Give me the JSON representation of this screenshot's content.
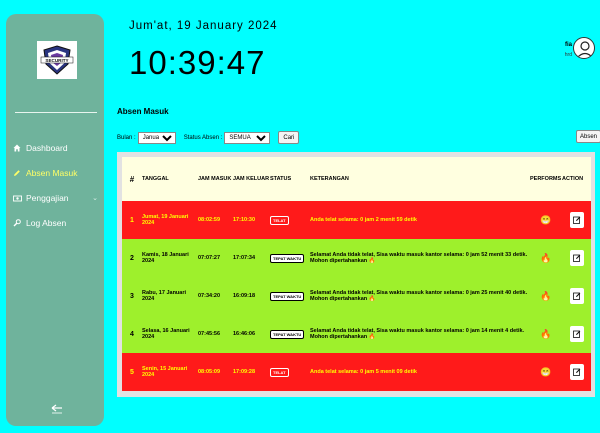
{
  "header": {
    "date": "Jum'at, 19 January 2024",
    "time": "10:39:47",
    "user_name": "fia",
    "user_role": "hrd"
  },
  "sidebar": {
    "logo_text": "SECURITY",
    "items": [
      {
        "label": "Dashboard",
        "icon": "home-icon",
        "active": false
      },
      {
        "label": "Absen Masuk",
        "icon": "pencil-icon",
        "active": true
      },
      {
        "label": "Penggajian",
        "icon": "money-icon",
        "active": false,
        "has_children": true
      },
      {
        "label": "Log Absen",
        "icon": "wrench-icon",
        "active": false
      }
    ]
  },
  "main": {
    "title": "Absen Masuk",
    "filter": {
      "bulan_label": "Bulan :",
      "bulan_value": "Januari",
      "status_label": "Status Absen :",
      "status_value": "SEMUA",
      "cari_label": "Cari"
    },
    "absen_button": "Absen"
  },
  "table": {
    "headers": {
      "no": "#",
      "tanggal": "TANGGAL",
      "jam_masuk": "JAM MASUK",
      "jam_keluar": "JAM KELUAR",
      "status": "STATUS",
      "keterangan": "KETERANGAN",
      "performs": "PERFORMS",
      "action": "ACTION"
    },
    "rows": [
      {
        "no": "1",
        "tanggal": "Jumat, 19 Januari 2024",
        "jam_masuk": "08:02:59",
        "jam_keluar": "17:10:30",
        "status": "TELAT",
        "keterangan": "Anda telat selama: 0 jam 2 menit 59 detik",
        "performs": "😁",
        "tone": "red"
      },
      {
        "no": "2",
        "tanggal": "Kamis, 18 Januari 2024",
        "jam_masuk": "07:07:27",
        "jam_keluar": "17:07:34",
        "status": "TEPAT WAKTU",
        "keterangan": "Selamat Anda tidak telat, Sisa waktu masuk kantor selama: 0 jam 52 menit 33 detik. Mohon dipertahankan 🔥",
        "performs": "🔥",
        "tone": "green"
      },
      {
        "no": "3",
        "tanggal": "Rabu, 17 Januari 2024",
        "jam_masuk": "07:34:20",
        "jam_keluar": "16:09:18",
        "status": "TEPAT WAKTU",
        "keterangan": "Selamat Anda tidak telat, Sisa waktu masuk kantor selama: 0 jam 25 menit 40 detik. Mohon dipertahankan 🔥",
        "performs": "🔥",
        "tone": "green"
      },
      {
        "no": "4",
        "tanggal": "Selasa, 16 Januari 2024",
        "jam_masuk": "07:45:56",
        "jam_keluar": "16:46:06",
        "status": "TEPAT WAKTU",
        "keterangan": "Selamat Anda tidak telat, Sisa waktu masuk kantor selama: 0 jam 14 menit 4 detik. Mohon dipertahankan 🔥",
        "performs": "🔥",
        "tone": "green"
      },
      {
        "no": "5",
        "tanggal": "Senin, 15 Januari 2024",
        "jam_masuk": "08:05:09",
        "jam_keluar": "17:09:28",
        "status": "TELAT",
        "keterangan": "Anda telat selama: 0 jam 5 menit 09 detik",
        "performs": "😁",
        "tone": "red"
      }
    ]
  },
  "colors": {
    "page_bg": "#00ffff",
    "sidebar_bg": "#6fb39c",
    "row_late": "#ff1a1a",
    "row_ontime": "#9ef02c",
    "header_bg": "#ffffe0",
    "active_nav": "#ffff66"
  }
}
